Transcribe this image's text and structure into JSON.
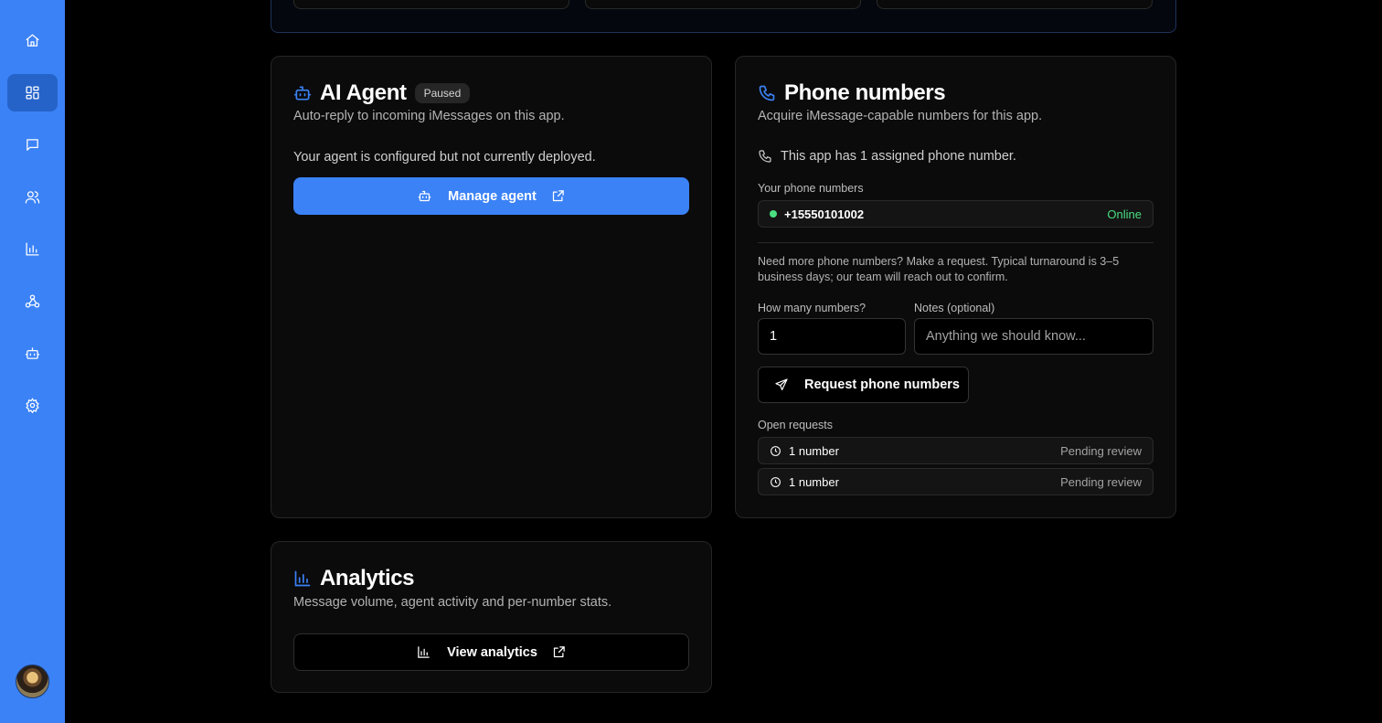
{
  "sidebar": {
    "items": [
      {
        "name": "home-icon"
      },
      {
        "name": "dashboard-icon",
        "active": true
      },
      {
        "name": "message-icon"
      },
      {
        "name": "users-icon"
      },
      {
        "name": "bar-chart-icon"
      },
      {
        "name": "webhook-icon"
      },
      {
        "name": "bot-icon"
      },
      {
        "name": "gear-icon"
      }
    ],
    "accent": "#3b82f6"
  },
  "ai_agent": {
    "title": "AI Agent",
    "badge": "Paused",
    "subtitle": "Auto-reply to incoming iMessages on this app.",
    "status_text": "Your agent is configured but not currently deployed.",
    "manage_label": "Manage agent"
  },
  "phone_numbers": {
    "title": "Phone numbers",
    "subtitle": "Acquire iMessage-capable numbers for this app.",
    "assigned_text": "This app has 1 assigned phone number.",
    "your_numbers_label": "Your phone numbers",
    "numbers": [
      {
        "number": "+15550101002",
        "status": "Online"
      }
    ],
    "request_info": "Need more phone numbers? Make a request. Typical turnaround is 3–5 business days; our team will reach out to confirm.",
    "how_many_label": "How many numbers?",
    "how_many_value": "1",
    "notes_label": "Notes (optional)",
    "notes_placeholder": "Anything we should know...",
    "request_button": "Request phone numbers",
    "open_requests_label": "Open requests",
    "open_requests": [
      {
        "text": "1 number",
        "status": "Pending review"
      },
      {
        "text": "1 number",
        "status": "Pending review"
      }
    ]
  },
  "analytics": {
    "title": "Analytics",
    "subtitle": "Message volume, agent activity and per-number stats.",
    "view_label": "View analytics"
  }
}
